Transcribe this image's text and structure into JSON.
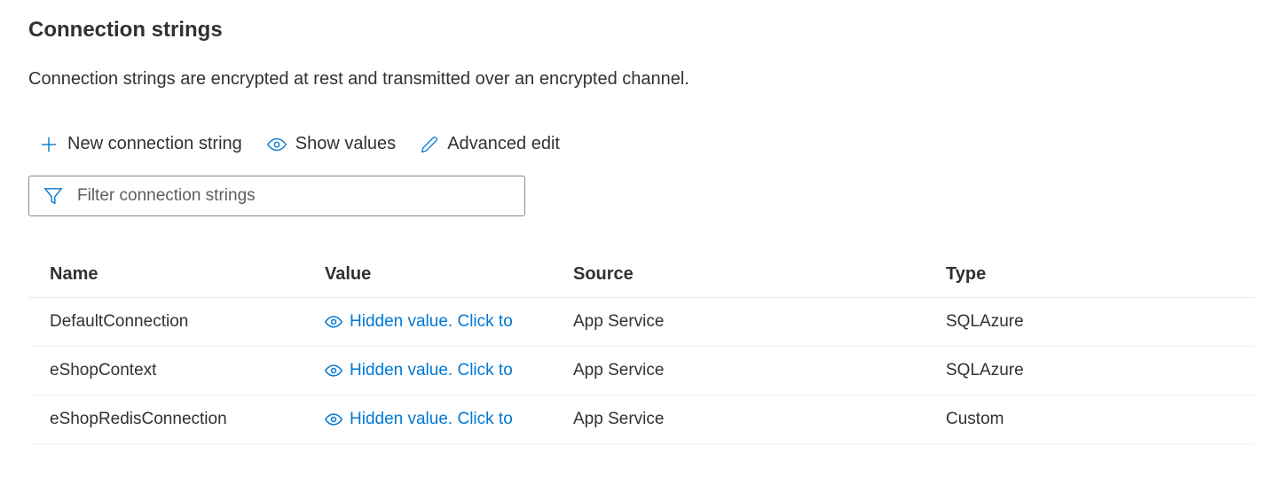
{
  "section": {
    "title": "Connection strings",
    "description": "Connection strings are encrypted at rest and transmitted over an encrypted channel."
  },
  "toolbar": {
    "new_label": "New connection string",
    "show_values_label": "Show values",
    "advanced_edit_label": "Advanced edit"
  },
  "filter": {
    "placeholder": "Filter connection strings"
  },
  "table": {
    "headers": {
      "name": "Name",
      "value": "Value",
      "source": "Source",
      "type": "Type"
    },
    "hidden_value_text": "Hidden value. Click to",
    "rows": [
      {
        "name": "DefaultConnection",
        "source": "App Service",
        "type": "SQLAzure"
      },
      {
        "name": "eShopContext",
        "source": "App Service",
        "type": "SQLAzure"
      },
      {
        "name": "eShopRedisConnection",
        "source": "App Service",
        "type": "Custom"
      }
    ]
  }
}
